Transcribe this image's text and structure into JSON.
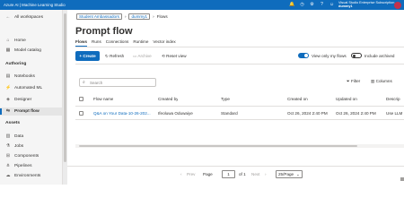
{
  "topbar": {
    "app_title": "Azure AI | Machine Learning Studio",
    "icons": [
      "notification-icon",
      "clock-icon",
      "gear-icon",
      "help-icon",
      "smiley-icon"
    ],
    "subscription": "Visual Studio Enterprise Subscription",
    "workspace": "dummy1",
    "avatar_initials": "",
    "brand_color": "#0f6cbd"
  },
  "sidebar": {
    "items": [
      {
        "label": "All workspaces",
        "icon": "back-arrow-icon"
      },
      {
        "label": "Home",
        "icon": "home-icon"
      },
      {
        "label": "Model catalog",
        "icon": "catalog-icon"
      }
    ],
    "sections": [
      {
        "title": "Authoring",
        "items": [
          {
            "label": "Notebooks",
            "icon": "notebook-icon"
          },
          {
            "label": "Automated ML",
            "icon": "automl-icon"
          },
          {
            "label": "Designer",
            "icon": "designer-icon"
          },
          {
            "label": "Prompt flow",
            "icon": "flow-icon",
            "active": true
          }
        ]
      },
      {
        "title": "Assets",
        "items": [
          {
            "label": "Data",
            "icon": "data-icon"
          },
          {
            "label": "Jobs",
            "icon": "jobs-icon"
          },
          {
            "label": "Components",
            "icon": "components-icon"
          },
          {
            "label": "Pipelines",
            "icon": "pipelines-icon"
          },
          {
            "label": "Environments",
            "icon": "environments-icon"
          }
        ]
      }
    ]
  },
  "breadcrumb": {
    "root": "Student Ambassadors",
    "workspace": "dummy1",
    "current": "Flows"
  },
  "page": {
    "title": "Prompt flow",
    "tabs": [
      "Flows",
      "Runs",
      "Connections",
      "Runtime",
      "Vector index"
    ],
    "active_tab": "Flows"
  },
  "toolbar": {
    "create": "Create",
    "refresh": "Refresh",
    "archive": "Archive",
    "reset_view": "Reset view",
    "view_only_mine": "View only my flows",
    "view_only_mine_on": true,
    "include_archived": "Include archived",
    "include_archived_on": false
  },
  "search": {
    "placeholder": "Search",
    "value": ""
  },
  "filters": {
    "filter": "Filter",
    "columns": "Columns"
  },
  "table": {
    "headers": [
      "Flow name",
      "Created by",
      "Type",
      "Created on",
      "Updated on",
      "Descrip"
    ],
    "rows": [
      {
        "flow_name": "Q&A on Your Data-10-26-202...",
        "created_by": "Ifeoluwa Oduwaiye",
        "type": "Standard",
        "created_on": "Oct 26, 2024 2:40 PM",
        "updated_on": "Oct 26, 2024 2:40 PM",
        "description": "Use LLM"
      }
    ]
  },
  "pager": {
    "prev": "Prev",
    "page_label": "Page",
    "page_value": "1",
    "of_label": "of 1",
    "next": "Next",
    "page_size": "25/Page"
  }
}
